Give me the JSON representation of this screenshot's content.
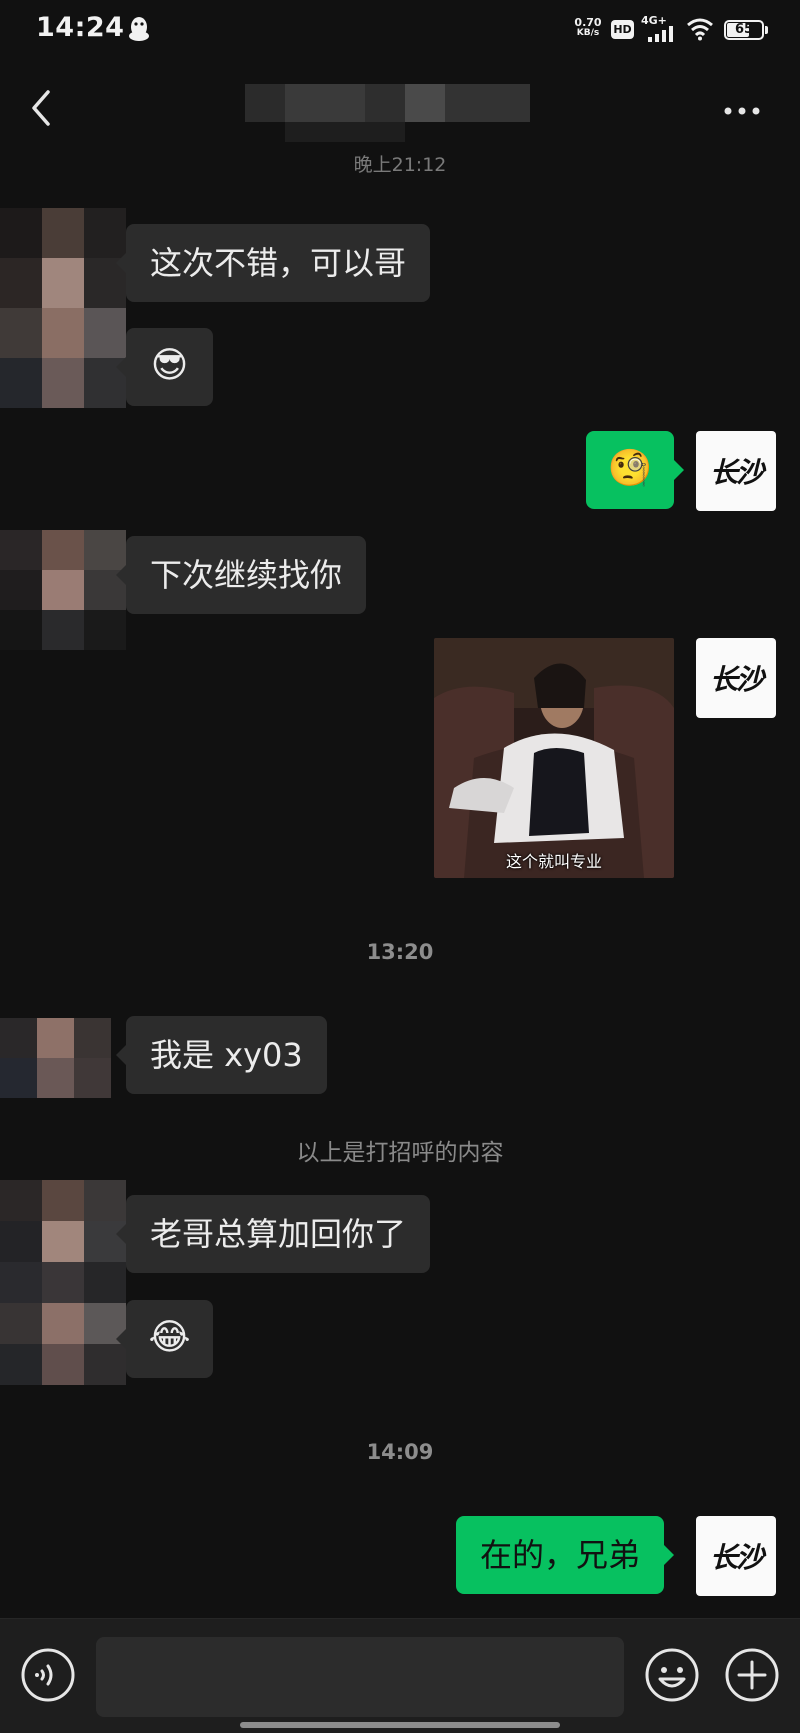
{
  "status_bar": {
    "time": "14:24",
    "net_speed_value": "0.70",
    "net_speed_unit": "KB/s",
    "hd_label": "HD",
    "signal_label": "4G+",
    "battery_level": "65"
  },
  "header": {
    "contact_name": "",
    "back_icon": "chevron-left-icon",
    "more_icon": "ellipsis-icon"
  },
  "chat": {
    "prev_time": "晚上21:12",
    "messages": {
      "m1": "这次不错，可以哥",
      "m2_emoji": "😎",
      "m3_emoji": "🧐",
      "m4": "下次继续找你",
      "m5_caption": "这个就叫专业",
      "time_2": "13:20",
      "m6": "我是 xy03",
      "system_note": "以上是打招呼的内容",
      "m7": "老哥总算加回你了",
      "m8_emoji": "😂",
      "time_3": "14:09",
      "m9": "在的，兄弟"
    },
    "my_avatar_text": "长沙"
  },
  "input_bar": {
    "voice_icon": "voice-icon",
    "input_value": "",
    "emoji_icon": "smiley-icon",
    "plus_icon": "plus-circle-icon"
  },
  "colors": {
    "background": "#111111",
    "bubble_incoming": "#2c2c2c",
    "bubble_outgoing": "#07c160"
  }
}
